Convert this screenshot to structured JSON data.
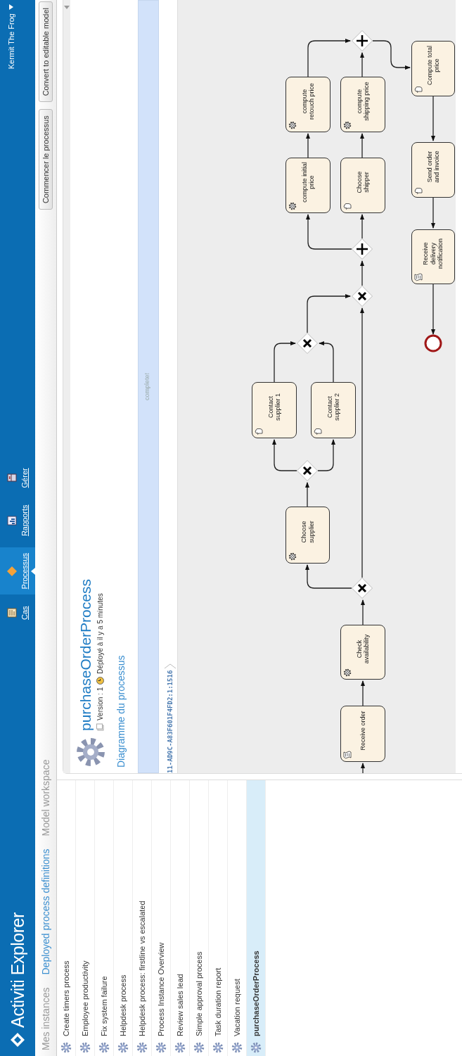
{
  "header": {
    "logo": "Activiti Explorer",
    "nav": [
      {
        "label": "Cas",
        "kind": "cases",
        "selected": false
      },
      {
        "label": "Processus",
        "kind": "processes",
        "selected": true
      },
      {
        "label": "Rapports",
        "kind": "reports",
        "selected": false
      },
      {
        "label": "Gérer",
        "kind": "manage",
        "selected": false
      }
    ],
    "user": "Kermit The Frog"
  },
  "tabs": [
    {
      "label": "Mes instances",
      "selected": false
    },
    {
      "label": "Deployed process definitions",
      "selected": true
    },
    {
      "label": "Model workspace",
      "selected": false
    }
  ],
  "actions": [
    "Commencer le processus",
    "Convert to editable model"
  ],
  "processes": [
    {
      "name": "Create timers process",
      "selected": false
    },
    {
      "name": "Employee productivity",
      "selected": false
    },
    {
      "name": "Fix system failure",
      "selected": false
    },
    {
      "name": "Helpdesk process",
      "selected": false
    },
    {
      "name": "Helpdesk process: firstline vs escalated",
      "selected": false
    },
    {
      "name": "Process Instance Overview",
      "selected": false
    },
    {
      "name": "Review sales lead",
      "selected": false
    },
    {
      "name": "Simple approval process",
      "selected": false
    },
    {
      "name": "Task duration report",
      "selected": false
    },
    {
      "name": "Vacation request",
      "selected": false
    },
    {
      "name": "purchaseOrderProcess",
      "selected": true
    }
  ],
  "detail": {
    "title": "purchaseOrderProcess",
    "version": "Version : 1",
    "deployed": "Déployé à il y a 5 minutes",
    "section": "Diagramme du processus",
    "progress": {
      "level": 1,
      "label": "complete!"
    },
    "breadcrumb": "11-AD9C-A83F601F4FD2:1:1516"
  },
  "diagram": {
    "tasks": [
      {
        "label": "Receive order",
        "kind": "script"
      },
      {
        "label": "Check availability",
        "kind": "service"
      },
      {
        "label": "Choose supplier",
        "kind": "service"
      },
      {
        "label": "Contact supplier 1",
        "kind": "user"
      },
      {
        "label": "Contact supplier 2",
        "kind": "user"
      },
      {
        "label": "compute initial price",
        "kind": "service"
      },
      {
        "label": "Choose shipper",
        "kind": "user"
      },
      {
        "label": "compute retouch price",
        "kind": "service"
      },
      {
        "label": "compute shipping price",
        "kind": "service"
      },
      {
        "label": "Compute total price",
        "kind": "user"
      },
      {
        "label": "Send order and invoice",
        "kind": "user"
      },
      {
        "label": "Receive delivery notification",
        "kind": "script"
      }
    ],
    "gateways": [
      {
        "kind": "exclusive"
      },
      {
        "kind": "exclusive"
      },
      {
        "kind": "exclusive"
      },
      {
        "kind": "exclusive"
      },
      {
        "kind": "parallel"
      },
      {
        "kind": "parallel"
      }
    ],
    "events": [
      {
        "kind": "end"
      }
    ]
  }
}
